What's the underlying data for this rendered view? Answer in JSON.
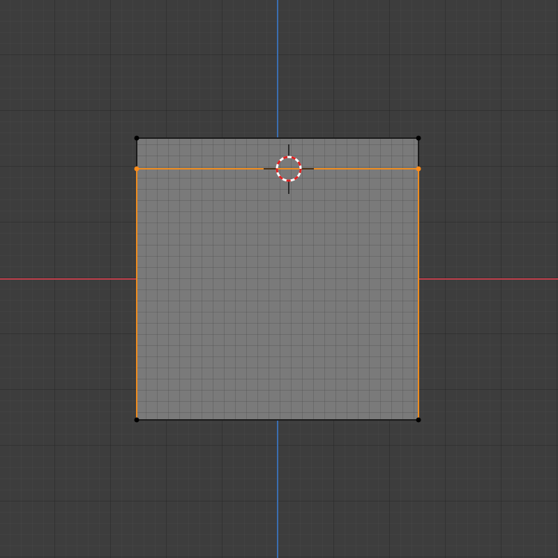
{
  "app": "3d-viewport",
  "view": "top-orthographic",
  "colors": {
    "background": "#3d3d3d",
    "x_axis": "#c0404c",
    "y_axis": "#3a6eb0",
    "face": "#7a7a7a",
    "selected_edge": "#f08c1e",
    "unselected_edge": "#1a1a1a",
    "vertex": "#000000",
    "selected_vertex": "#ff8c1a",
    "cursor_ring_red": "#e02020",
    "cursor_ring_white": "#ffffff"
  },
  "icons": {
    "cursor": "3d-cursor-icon"
  },
  "mesh": {
    "object": "plane",
    "mode": "edit-mode",
    "selection": "edge-loop-cut"
  }
}
